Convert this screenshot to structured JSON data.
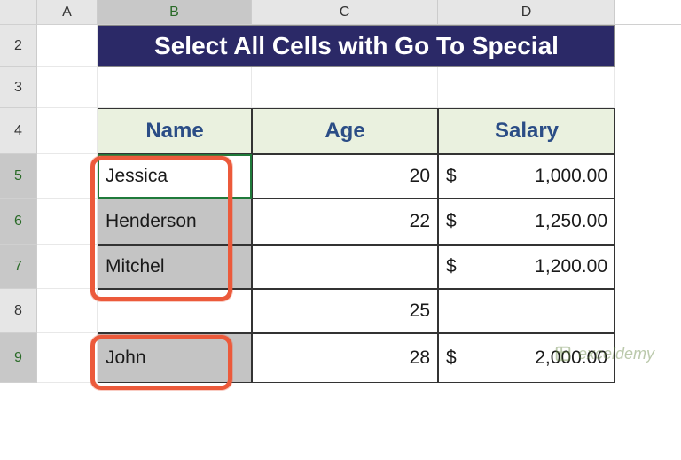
{
  "columns": {
    "A": "A",
    "B": "B",
    "C": "C",
    "D": "D"
  },
  "rows": {
    "r2": "2",
    "r3": "3",
    "r4": "4",
    "r5": "5",
    "r6": "6",
    "r7": "7",
    "r8": "8",
    "r9": "9"
  },
  "title": "Select All Cells with Go To Special",
  "headers": {
    "name": "Name",
    "age": "Age",
    "salary": "Salary"
  },
  "data": {
    "r5": {
      "name": "Jessica",
      "age": "20",
      "cur": "$",
      "salary": "1,000.00"
    },
    "r6": {
      "name": "Henderson",
      "age": "22",
      "cur": "$",
      "salary": "1,250.00"
    },
    "r7": {
      "name": "Mitchel",
      "age": "",
      "cur": "$",
      "salary": "1,200.00"
    },
    "r8": {
      "name": "",
      "age": "25",
      "cur": "",
      "salary": ""
    },
    "r9": {
      "name": "John",
      "age": "28",
      "cur": "$",
      "salary": "2,000.00"
    }
  },
  "watermark": "exceldemy",
  "chart_data": {
    "type": "table",
    "title": "Select All Cells with Go To Special",
    "columns": [
      "Name",
      "Age",
      "Salary"
    ],
    "rows": [
      {
        "Name": "Jessica",
        "Age": 20,
        "Salary": 1000.0
      },
      {
        "Name": "Henderson",
        "Age": 22,
        "Salary": 1250.0
      },
      {
        "Name": "Mitchel",
        "Age": null,
        "Salary": 1200.0
      },
      {
        "Name": null,
        "Age": 25,
        "Salary": null
      },
      {
        "Name": "John",
        "Age": 28,
        "Salary": 2000.0
      }
    ],
    "selected_cells": [
      "B5",
      "B6",
      "B7",
      "B9"
    ],
    "active_cell": "B5"
  }
}
